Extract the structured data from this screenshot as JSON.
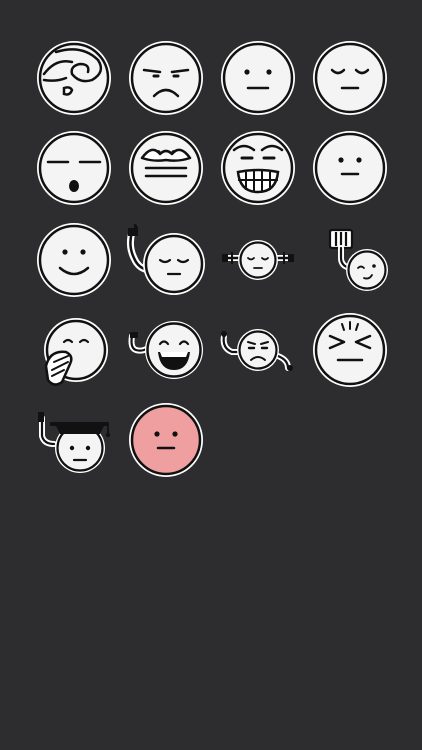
{
  "screen": {
    "background": "#2d2d2f"
  },
  "palette": {
    "face_fill": "#ffffff",
    "face_shade": "#d9d9d9",
    "outline": "#111111",
    "sticker_border": "#ffffff",
    "blush_face_fill": "#f0a3a3",
    "blush_face_shade": "#e07f7f"
  },
  "stickers": [
    {
      "name": "emoji-sticker-eye-swirl",
      "icon": "swirl-eye-face-icon"
    },
    {
      "name": "emoji-sticker-grumpy",
      "icon": "grumpy-face-icon"
    },
    {
      "name": "emoji-sticker-neutral",
      "icon": "neutral-face-icon"
    },
    {
      "name": "emoji-sticker-content",
      "icon": "content-face-icon"
    },
    {
      "name": "emoji-sticker-shocked-flat",
      "icon": "flat-eyes-open-mouth-face-icon"
    },
    {
      "name": "emoji-sticker-lips",
      "icon": "big-lips-face-icon"
    },
    {
      "name": "emoji-sticker-grin",
      "icon": "grinning-teeth-face-icon"
    },
    {
      "name": "emoji-sticker-small-eyes",
      "icon": "small-eyes-face-icon"
    },
    {
      "name": "emoji-sticker-smile",
      "icon": "smile-face-icon"
    },
    {
      "name": "emoji-sticker-thumbs-up",
      "icon": "thumbs-up-face-icon"
    },
    {
      "name": "emoji-sticker-arms-out",
      "icon": "arms-out-face-icon"
    },
    {
      "name": "emoji-sticker-plug-wink",
      "icon": "plug-wink-face-icon"
    },
    {
      "name": "emoji-sticker-yawn",
      "icon": "yawning-face-icon"
    },
    {
      "name": "emoji-sticker-laughing",
      "icon": "laughing-face-icon"
    },
    {
      "name": "emoji-sticker-annoyed",
      "icon": "annoyed-face-icon"
    },
    {
      "name": "emoji-sticker-squint",
      "icon": "squinting-face-icon"
    },
    {
      "name": "emoji-sticker-graduate",
      "icon": "graduate-face-icon"
    },
    {
      "name": "emoji-sticker-pink",
      "icon": "pink-neutral-face-icon"
    }
  ]
}
